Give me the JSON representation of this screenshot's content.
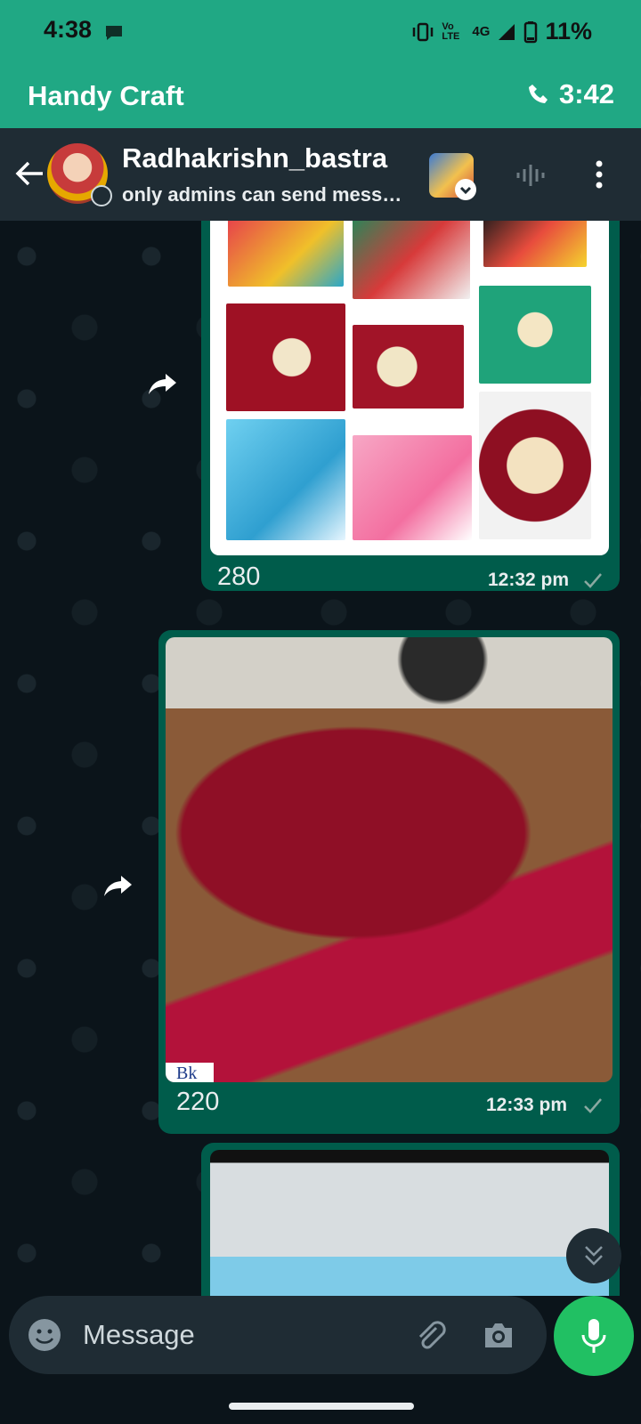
{
  "status_bar": {
    "time": "4:38",
    "network": "4G",
    "volte": "Vo LTE",
    "battery": "11%"
  },
  "call_bar": {
    "title": "Handy Craft",
    "timer": "3:42"
  },
  "header": {
    "name": "Radhakrishn_bastra",
    "subtitle": "only admins can send messages"
  },
  "messages": [
    {
      "caption": "280",
      "time": "12:32 pm",
      "status": "sent"
    },
    {
      "caption": "220",
      "time": "12:33 pm",
      "status": "sent",
      "watermark": "Bk"
    }
  ],
  "composer": {
    "placeholder": "Message"
  },
  "colors": {
    "accent": "#20a884",
    "bubble_out": "#005c4b",
    "header_bg": "#1f2c34",
    "chat_bg": "#0b141a",
    "mic": "#21c063"
  },
  "icons": [
    "back-arrow-icon",
    "voice-wave-icon",
    "more-vert-icon",
    "forward-icon",
    "tick-icon",
    "emoji-icon",
    "attach-icon",
    "camera-icon",
    "mic-icon",
    "chevrons-down-icon",
    "phone-icon",
    "chat-status-icon",
    "vibrate-icon",
    "signal-icon",
    "battery-icon"
  ]
}
